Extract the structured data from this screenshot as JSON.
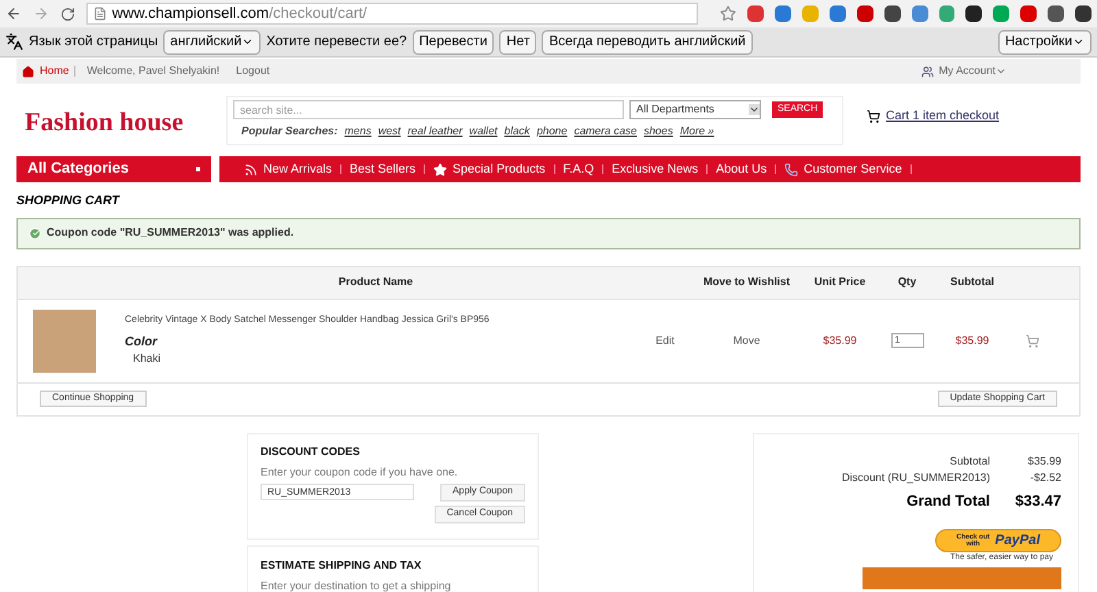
{
  "browser": {
    "url_host": "www.championsell.com",
    "url_path": "/checkout/cart/"
  },
  "translate_bar": {
    "prompt": "Язык этой страницы",
    "language": "английский",
    "question": "Хотите перевести ее?",
    "buttons": [
      "Перевести",
      "Нет",
      "Всегда переводить английский"
    ],
    "settings": "Настройки"
  },
  "top_nav": {
    "home": "Home",
    "welcome": "Welcome, Pavel Shelyakin!",
    "logout": "Logout",
    "account": "My Account"
  },
  "header": {
    "logo": "Fashion house",
    "search_placeholder": "search site...",
    "department": "All Departments",
    "search_button": "SEARCH",
    "popular_label": "Popular Searches:",
    "popular": [
      "mens",
      "west",
      "real leather",
      "wallet",
      "black",
      "phone",
      "camera case",
      "shoes",
      "More »"
    ],
    "cart": "Cart 1 item checkout"
  },
  "categories": "All Categories",
  "main_nav": [
    {
      "label": "New Arrivals",
      "kind": "rss"
    },
    {
      "label": "Best Sellers",
      "kind": "plain"
    },
    {
      "label": "Special Products",
      "kind": "star"
    },
    {
      "label": "F.A.Q",
      "kind": "plain"
    },
    {
      "label": "Exclusive News",
      "kind": "plain"
    },
    {
      "label": "About Us",
      "kind": "plain"
    },
    {
      "label": "Customer Service",
      "kind": "phone"
    }
  ],
  "page_title": "SHOPPING CART",
  "alert": "Coupon code \"RU_SUMMER2013\" was applied.",
  "table": {
    "columns": [
      "Product Name",
      "Move to Wishlist",
      "Unit Price",
      "Qty",
      "Subtotal"
    ],
    "rows": [
      {
        "name": "Celebrity Vintage X Body Satchel Messenger Shoulder Handbag Jessica Gril's BP956",
        "option_label": "Color",
        "option_value": "Khaki",
        "edit": "Edit",
        "move": "Move",
        "unit_price": "$35.99",
        "qty": "1",
        "subtotal": "$35.99"
      }
    ]
  },
  "continue_button": "Continue Shopping",
  "update_button": "Update Shopping Cart",
  "discount": {
    "title": "DISCOUNT CODES",
    "hint": "Enter your coupon code if you have one.",
    "code": "RU_SUMMER2013",
    "apply": "Apply Coupon",
    "cancel": "Cancel Coupon"
  },
  "shipping": {
    "title": "ESTIMATE SHIPPING AND TAX",
    "hint": "Enter your destination to get a shipping"
  },
  "totals": [
    {
      "label": "Subtotal",
      "value": "$35.99",
      "kind": "line"
    },
    {
      "label": "Discount (RU_SUMMER2013)",
      "value": "-$2.52",
      "kind": "line"
    },
    {
      "label": "Grand Total",
      "value": "$33.47",
      "kind": "grand"
    }
  ],
  "paypal": {
    "line1": "Check out",
    "line2": "with",
    "brand": "PayPal",
    "tagline": "The safer, easier way to pay"
  }
}
